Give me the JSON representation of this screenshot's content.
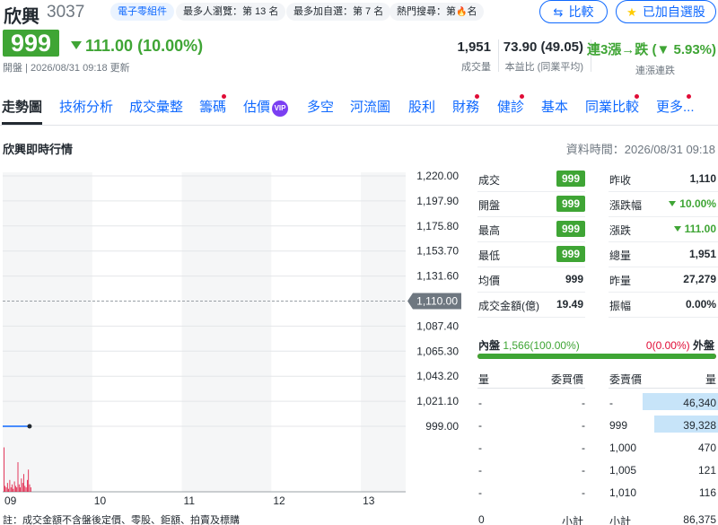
{
  "header": {
    "name": "欣興",
    "code": "3037",
    "chips": [
      {
        "label": "電子零組件"
      },
      {
        "label": "最多人瀏覽：第 13 名"
      },
      {
        "label": "最多加自選：第 7 名"
      },
      {
        "label_prefix": "熱門搜尋：第",
        "label_suffix": "名"
      }
    ],
    "compare_button": "比較",
    "watchlist_button": "已加自選股",
    "price": "999",
    "change": "111.00 (10.00%)",
    "updated": "開盤 | 2026/08/31 09:18 更新",
    "stats": [
      {
        "value": "1,951",
        "label": "成交量"
      },
      {
        "value": "73.90 (49.05)",
        "label": "本益比 (同業平均)"
      },
      {
        "value": "連3漲→跌 (▼ 5.93%)",
        "label": "連漲連跌"
      }
    ],
    "colors": {
      "down_green": "#3fa535",
      "up_red": "#e00c36",
      "link_blue": "#0f69ff"
    }
  },
  "tabs": [
    {
      "label": "走勢圖",
      "active": true,
      "dot": false
    },
    {
      "label": "技術分析",
      "dot": false
    },
    {
      "label": "成交彙整",
      "dot": false
    },
    {
      "label": "籌碼",
      "dot": true
    },
    {
      "label": "估價",
      "dot": false,
      "vip": "VIP"
    },
    {
      "label": "多空",
      "dot": false
    },
    {
      "label": "河流圖",
      "dot": false
    },
    {
      "label": "股利",
      "dot": false
    },
    {
      "label": "財務",
      "dot": true
    },
    {
      "label": "健診",
      "dot": true
    },
    {
      "label": "基本",
      "dot": false
    },
    {
      "label": "同業比較",
      "dot": true
    },
    {
      "label": "更多...",
      "dot": true
    }
  ],
  "section": {
    "title": "欣興即時行情",
    "time": "資料時間：2026/08/31 09:18"
  },
  "chart_data": {
    "type": "line",
    "title": "",
    "y_ticks": [
      "1,220.00",
      "1,197.90",
      "1,175.80",
      "1,153.70",
      "1,131.60",
      "1,110.00",
      "1,087.40",
      "1,065.30",
      "1,043.20",
      "1,021.10",
      "999.00"
    ],
    "ylim": [
      999,
      1221
    ],
    "reference_price": 1110,
    "x_ticks": [
      "09",
      "10",
      "11",
      "12",
      "13"
    ],
    "xlim": [
      0,
      270
    ],
    "price_series": {
      "x": [
        0,
        18
      ],
      "y": [
        999,
        999
      ]
    },
    "volume_bars": [
      30,
      4,
      3,
      6,
      2,
      8,
      3,
      5,
      2,
      7,
      4,
      3,
      20,
      5,
      3,
      9,
      6,
      12,
      4,
      3,
      8,
      15,
      5,
      3
    ],
    "volume_max": 40,
    "volume_color": "#e00c36",
    "line_color": "#0f69ff"
  },
  "quote": {
    "left": [
      {
        "label": "成交",
        "value": "999",
        "badge": true
      },
      {
        "label": "開盤",
        "value": "999",
        "badge": true
      },
      {
        "label": "最高",
        "value": "999",
        "badge": true
      },
      {
        "label": "最低",
        "value": "999",
        "badge": true
      },
      {
        "label": "均價",
        "value": "999"
      },
      {
        "label": "成交金額(億)",
        "value": "19.49"
      }
    ],
    "right": [
      {
        "label": "昨收",
        "value": "1,110"
      },
      {
        "label": "漲跌幅",
        "value": "10.00%",
        "down": true
      },
      {
        "label": "漲跌",
        "value": "111.00",
        "down": true
      },
      {
        "label": "總量",
        "value": "1,951"
      },
      {
        "label": "昨量",
        "value": "27,279"
      },
      {
        "label": "振幅",
        "value": "0.00%"
      }
    ]
  },
  "inout": {
    "in_label": "內盤",
    "in_value": "1,566",
    "in_pct": "(100.00%)",
    "out_value": "0",
    "out_pct": "(0.00%)",
    "out_label": "外盤",
    "in_ratio": 1.0
  },
  "orderbook": {
    "headers": [
      "量",
      "委買價",
      "委賣價",
      "量"
    ],
    "rows": [
      {
        "bid_vol": "-",
        "bid": "-",
        "ask": "-",
        "ask_vol": "46,340",
        "ask_ratio": 1.0
      },
      {
        "bid_vol": "-",
        "bid": "-",
        "ask": "999",
        "ask_vol": "39,328",
        "ask_ratio": 0.85
      },
      {
        "bid_vol": "-",
        "bid": "-",
        "ask": "1,000",
        "ask_vol": "470",
        "ask_ratio": 0
      },
      {
        "bid_vol": "-",
        "bid": "-",
        "ask": "1,005",
        "ask_vol": "121",
        "ask_ratio": 0
      },
      {
        "bid_vol": "-",
        "bid": "-",
        "ask": "1,010",
        "ask_vol": "116",
        "ask_ratio": 0
      }
    ],
    "total_bid_vol": "0",
    "subtotal_label": "小計",
    "total_ask_vol": "86,375"
  },
  "note": "註：成交金額不含盤後定價、零股、鉅額、拍賣及標購"
}
